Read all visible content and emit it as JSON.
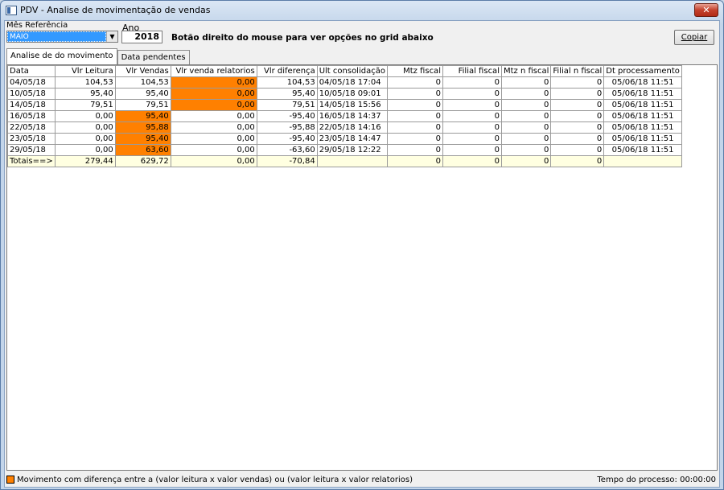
{
  "window": {
    "title": "PDV - Analise de movimentação de vendas",
    "close_label": "✕"
  },
  "form": {
    "month_label": "Mês Referência",
    "month_value": "MAIO",
    "year_label": "Ano",
    "year_value": "2018",
    "hint": "Botão direito do mouse para ver opções no grid abaixo",
    "copy_label": "Copiar"
  },
  "tabs": [
    {
      "label": "Analise de do movimento",
      "active": true
    },
    {
      "label": "Data pendentes",
      "active": false
    }
  ],
  "grid": {
    "columns": [
      "Data",
      "Vlr Leitura",
      "Vlr Vendas",
      "Vlr venda relatorios",
      "Vlr diferença",
      "Ult consolidação",
      "Mtz fiscal",
      "Filial fiscal",
      "Mtz n fiscal",
      "Filial n fiscal",
      "Dt processamento"
    ],
    "rows": [
      [
        "04/05/18",
        "104,53",
        "104,53",
        "0,00",
        "104,53",
        "04/05/18 17:04",
        "0",
        "0",
        "0",
        "0",
        "05/06/18 11:51"
      ],
      [
        "10/05/18",
        "95,40",
        "95,40",
        "0,00",
        "95,40",
        "10/05/18 09:01",
        "0",
        "0",
        "0",
        "0",
        "05/06/18 11:51"
      ],
      [
        "14/05/18",
        "79,51",
        "79,51",
        "0,00",
        "79,51",
        "14/05/18 15:56",
        "0",
        "0",
        "0",
        "0",
        "05/06/18 11:51"
      ],
      [
        "16/05/18",
        "0,00",
        "95,40",
        "0,00",
        "-95,40",
        "16/05/18 14:37",
        "0",
        "0",
        "0",
        "0",
        "05/06/18 11:51"
      ],
      [
        "22/05/18",
        "0,00",
        "95,88",
        "0,00",
        "-95,88",
        "22/05/18 14:16",
        "0",
        "0",
        "0",
        "0",
        "05/06/18 11:51"
      ],
      [
        "23/05/18",
        "0,00",
        "95,40",
        "0,00",
        "-95,40",
        "23/05/18 14:47",
        "0",
        "0",
        "0",
        "0",
        "05/06/18 11:51"
      ],
      [
        "29/05/18",
        "0,00",
        "63,60",
        "0,00",
        "-63,60",
        "29/05/18 12:22",
        "0",
        "0",
        "0",
        "0",
        "05/06/18 11:51"
      ]
    ],
    "highlighted": [
      [
        0,
        3
      ],
      [
        1,
        3
      ],
      [
        2,
        3
      ],
      [
        3,
        2
      ],
      [
        4,
        2
      ],
      [
        5,
        2
      ],
      [
        6,
        2
      ]
    ],
    "totals": [
      "Totais==>",
      "279,44",
      "629,72",
      "0,00",
      "-70,84",
      "",
      "0",
      "0",
      "0",
      "0",
      ""
    ],
    "highlight_color": "#ff8000",
    "totals_color": "#ffffe1"
  },
  "status": {
    "legend": "Movimento com diferença entre a (valor leitura x valor vendas) ou (valor leitura x valor relatorios)",
    "time": "Tempo do processo: 00:00:00"
  }
}
